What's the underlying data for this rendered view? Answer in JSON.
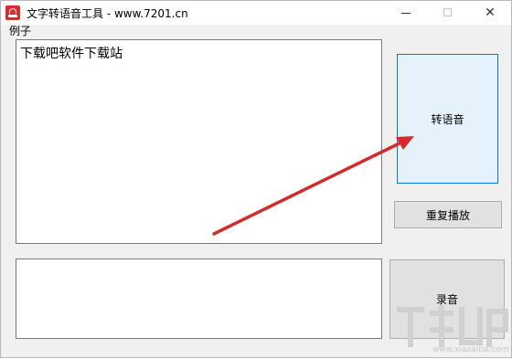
{
  "window": {
    "title": "文字转语音工具 - www.7201.cn",
    "minimize_glyph": "",
    "maximize_glyph": "",
    "close_glyph": "✕"
  },
  "menu": {
    "items": [
      {
        "label": "例子"
      }
    ]
  },
  "text_input": {
    "value": "下载吧软件下载站"
  },
  "record_output": {
    "value": ""
  },
  "buttons": {
    "convert_label": "转语音",
    "replay_label": "重复播放",
    "record_label": "录音"
  },
  "watermark": {
    "url": "www.xiazaiba.com"
  },
  "colors": {
    "arrow": "#d42a2a",
    "accent_border": "#0078d7",
    "button_face": "#e1e1e1",
    "focused_button_face": "#e5f1fb",
    "app_icon": "#e02a2a",
    "window_bg": "#f0f0f0"
  }
}
